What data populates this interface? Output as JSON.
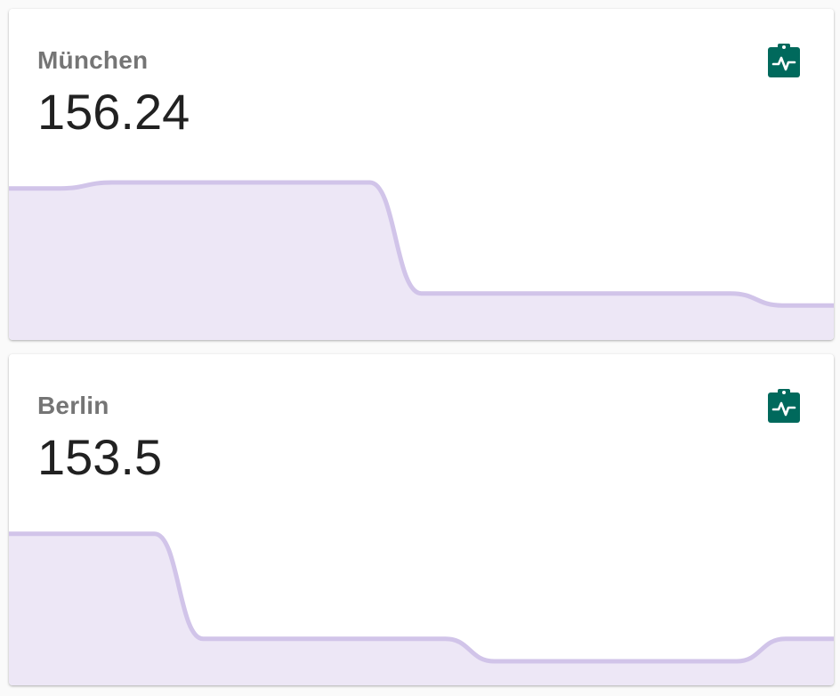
{
  "cards": [
    {
      "name": "München",
      "value": "156.24",
      "icon": "clipboard-pulse-icon",
      "trend": [
        0.0,
        0.0,
        0.04,
        0.04,
        0.04,
        0.04,
        0.04,
        0.04,
        -0.7,
        -0.7,
        -0.7,
        -0.7,
        -0.7,
        -0.7,
        -0.7,
        -0.78,
        -0.78
      ]
    },
    {
      "name": "Berlin",
      "value": "153.5",
      "icon": "clipboard-pulse-icon",
      "trend": [
        0.0,
        0.0,
        0.0,
        0.0,
        -0.7,
        -0.7,
        -0.7,
        -0.7,
        -0.7,
        -0.7,
        -0.85,
        -0.85,
        -0.85,
        -0.85,
        -0.85,
        -0.85,
        -0.7,
        -0.7
      ]
    }
  ],
  "colors": {
    "icon": "#00695c",
    "line": "#d1c4e9",
    "fill": "#ede7f6"
  }
}
